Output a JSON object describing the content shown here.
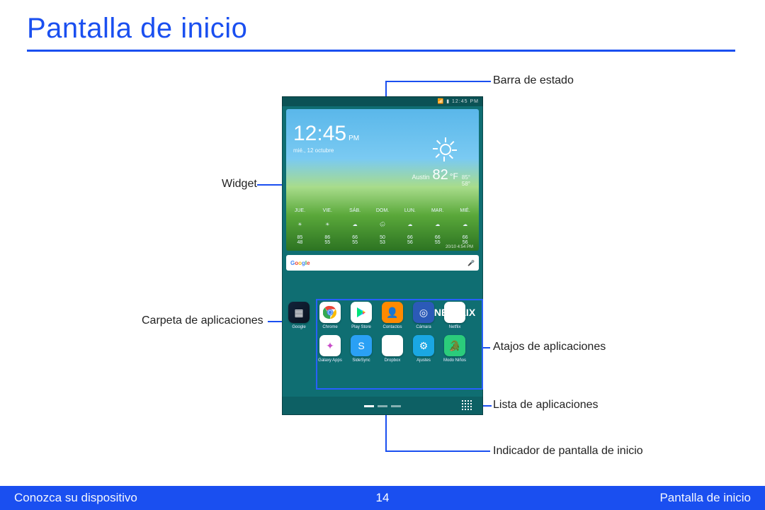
{
  "title": "Pantalla de inicio",
  "footer": {
    "left": "Conozca su dispositivo",
    "center": "14",
    "right": "Pantalla de inicio"
  },
  "callouts": {
    "status_bar": "Barra de estado",
    "widget": "Widget",
    "app_folder": "Carpeta de aplicaciones",
    "app_shortcuts": "Atajos de aplicaciones",
    "app_list": "Lista de aplicaciones",
    "home_indicator": "Indicador de pantalla de inicio"
  },
  "statusbar": {
    "carrier": "",
    "time": "12:45 PM"
  },
  "widget": {
    "time": "12:45",
    "period": "PM",
    "date": "mié., 12 octubre",
    "city": "Austin",
    "temp": "82",
    "unit": "°F",
    "hi": "85°",
    "lo": "58°",
    "days": [
      {
        "name": "JUE.",
        "hi": "85",
        "lo": "48"
      },
      {
        "name": "VIE.",
        "hi": "86",
        "lo": "55"
      },
      {
        "name": "SÁB.",
        "hi": "66",
        "lo": "55"
      },
      {
        "name": "DOM.",
        "hi": "50",
        "lo": "53"
      },
      {
        "name": "LUN.",
        "hi": "66",
        "lo": "56"
      },
      {
        "name": "MAR.",
        "hi": "66",
        "lo": "55"
      },
      {
        "name": "MIÉ.",
        "hi": "66",
        "lo": "56"
      }
    ],
    "updated": "20/10 4:54 PM"
  },
  "search": {
    "logo": "Google"
  },
  "apps_row1": [
    {
      "label": "Google",
      "color_class": "ic-folder",
      "glyph": "▦"
    },
    {
      "label": "Chrome",
      "color_class": "ic-chrome",
      "glyph": "◉"
    },
    {
      "label": "Play Store",
      "color_class": "ic-play",
      "glyph": "▶"
    },
    {
      "label": "Contactos",
      "color_class": "ic-cont",
      "glyph": "👤"
    },
    {
      "label": "Cámara",
      "color_class": "ic-cam",
      "glyph": "◎"
    },
    {
      "label": "Netflix",
      "color_class": "ic-nflx",
      "glyph": "NETFLIX"
    }
  ],
  "apps_row2": [
    {
      "label": "Galaxy Apps",
      "color_class": "ic-gapps",
      "glyph": "✦"
    },
    {
      "label": "SideSync",
      "color_class": "ic-ssync",
      "glyph": "S"
    },
    {
      "label": "Dropbox",
      "color_class": "ic-dbx",
      "glyph": "⬢"
    },
    {
      "label": "Ajustes",
      "color_class": "ic-set",
      "glyph": "⚙"
    },
    {
      "label": "Modo Niños",
      "color_class": "ic-kids",
      "glyph": "🐊"
    }
  ],
  "home_pages": {
    "count": 3,
    "active": 0
  }
}
